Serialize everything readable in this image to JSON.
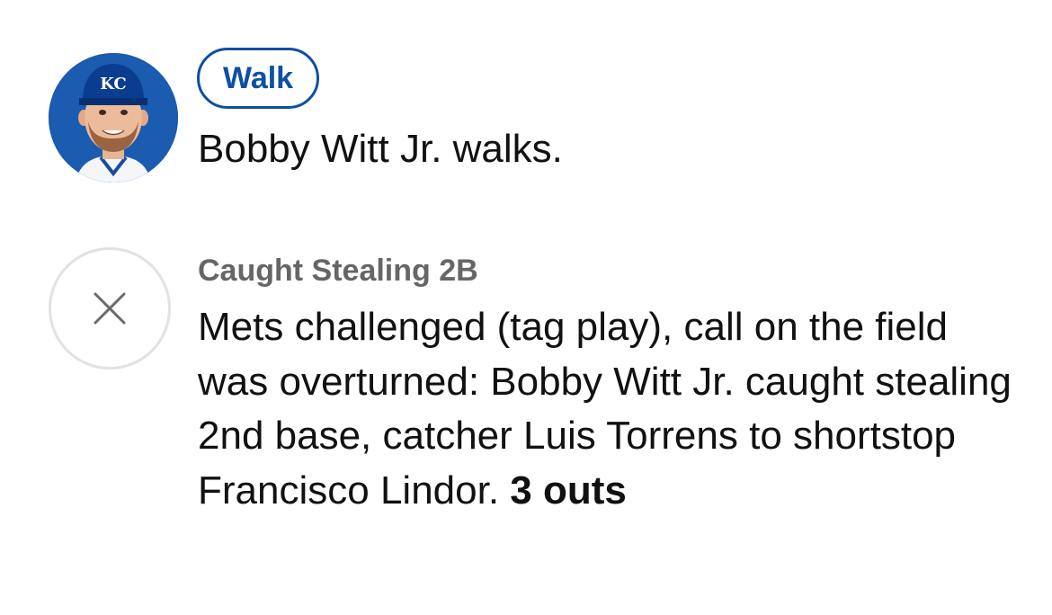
{
  "plays": {
    "walk": {
      "avatar_icon": "player-headshot",
      "event_label": "Walk",
      "description": "Bobby Witt Jr. walks.",
      "cap_logo_text": "KC",
      "accent_color": "#0d4fa5"
    },
    "caught_stealing": {
      "icon": "close-icon",
      "event_label": "Caught Stealing 2B",
      "description": "Mets challenged (tag play), call on the field was overturned: Bobby Witt Jr. caught stealing 2nd base, catcher Luis Torrens to shortstop Francisco Lindor.",
      "outs": "3 outs"
    }
  }
}
